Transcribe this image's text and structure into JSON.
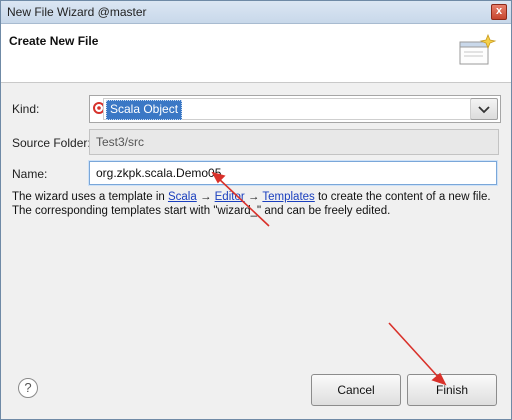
{
  "window": {
    "title": "New File Wizard @master",
    "close_label": "x"
  },
  "header": {
    "title": "Create New File",
    "icon": "new-file-wizard-icon"
  },
  "form": {
    "kind_label": "Kind:",
    "kind_value": "Scala Object",
    "source_label": "Source Folder:",
    "source_value": "Test3/src",
    "name_label": "Name:",
    "name_value": "org.zkpk.scala.Demo05"
  },
  "description": {
    "part1": "The wizard uses a template in ",
    "link_scala": "Scala",
    "link_editor": "Editor",
    "link_templates": "Templates",
    "part2": " to create the content of a new file.",
    "line2": "The corresponding templates start with \"wizard_\" and can be freely edited."
  },
  "buttons": {
    "help": "?",
    "cancel": "Cancel",
    "finish": "Finish"
  },
  "colors": {
    "annotation_arrow": "#d9312a",
    "selection": "#3b78c5",
    "link": "#1a3fbe"
  }
}
